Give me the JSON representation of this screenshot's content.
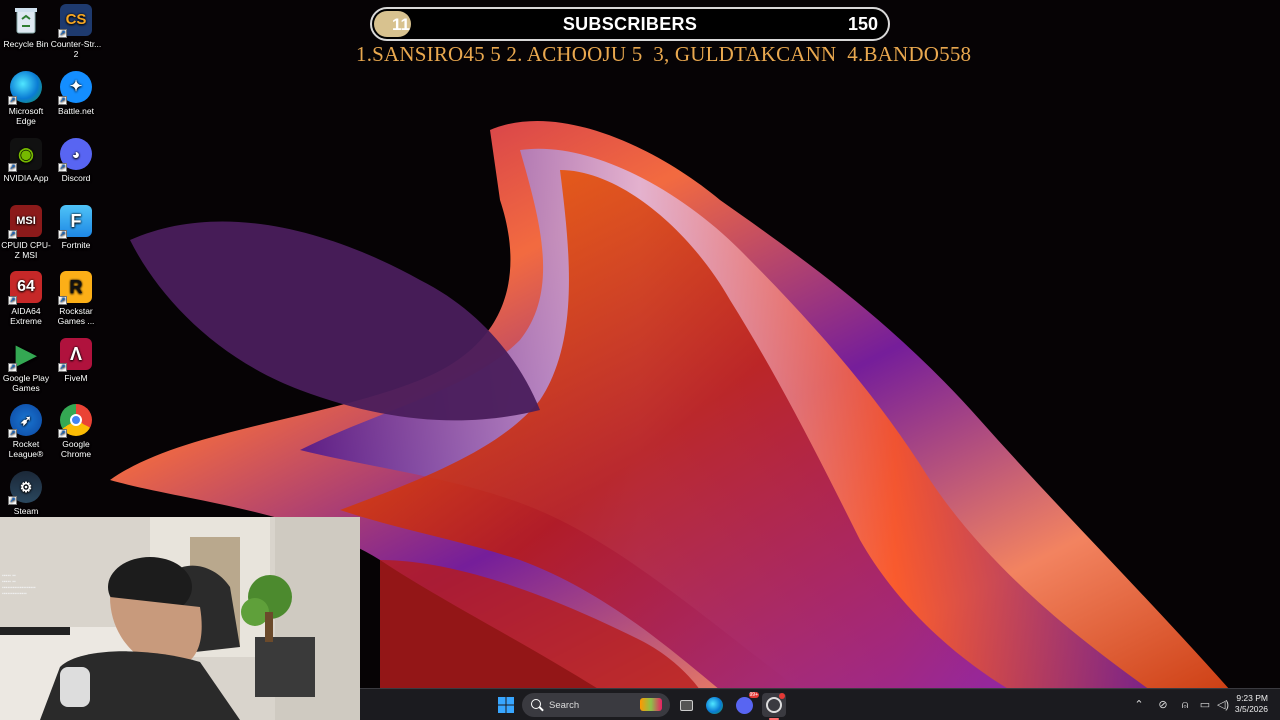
{
  "desktop": {
    "icons": [
      {
        "label": "Recycle Bin",
        "icon": "recycle-bin-icon"
      },
      {
        "label": "Counter-Str... 2",
        "icon": "counter-strike-icon"
      },
      {
        "label": "Microsoft Edge",
        "icon": "edge-icon"
      },
      {
        "label": "Battle.net",
        "icon": "battlenet-icon"
      },
      {
        "label": "NVIDIA App",
        "icon": "nvidia-icon"
      },
      {
        "label": "Discord",
        "icon": "discord-icon"
      },
      {
        "label": "CPUID CPU-Z MSI",
        "icon": "cpuz-icon"
      },
      {
        "label": "Fortnite",
        "icon": "fortnite-icon"
      },
      {
        "label": "AIDA64 Extreme",
        "icon": "aida64-icon"
      },
      {
        "label": "Rockstar Games ...",
        "icon": "rockstar-icon"
      },
      {
        "label": "Google Play Games",
        "icon": "google-play-games-icon"
      },
      {
        "label": "FiveM",
        "icon": "fivem-icon"
      },
      {
        "label": "Rocket League®",
        "icon": "rocket-league-icon"
      },
      {
        "label": "Google Chrome",
        "icon": "chrome-icon"
      },
      {
        "label": "Steam",
        "icon": "steam-icon"
      }
    ]
  },
  "overlay": {
    "current_subs": "11",
    "label": "SUBSCRIBERS",
    "goal": "150",
    "progress_fraction": 0.073,
    "fill_color": "#d8c28f",
    "leaderboard": "1.SANSIRO45 5 2. ACHOOJU 5  3, GULDTAKCANN  4.BANDO558"
  },
  "taskbar": {
    "search_placeholder": "Search",
    "discord_badge": "99+",
    "clock_time": "9:23 PM",
    "clock_date": "3/5/2026"
  }
}
